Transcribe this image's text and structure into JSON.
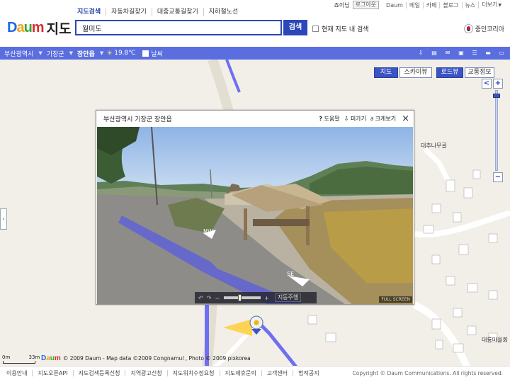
{
  "header": {
    "logo": {
      "d1": "D",
      "d2": "a",
      "d3": "u",
      "d4": "m"
    },
    "title": "지도",
    "tabs": [
      "지도검색",
      "자동차길찾기",
      "대중교통길찾기",
      "지하철노선"
    ],
    "search_value": "월미도",
    "search_button": "검색",
    "in_view_label": "현재 지도 내 검색",
    "user_nick": "죠이님",
    "logout": "로그아웃",
    "gnb": [
      "Daum",
      "메일",
      "카페",
      "블로그",
      "뉴스",
      "더보기"
    ],
    "gnb_more_arrow": "▼",
    "region": "중인코리아"
  },
  "location_bar": {
    "crumbs": [
      "부산광역시",
      "기장군",
      "장안읍"
    ],
    "separator": "▼",
    "weather_icon": "sun-icon",
    "temperature": "19.8℃",
    "weather_toggle": "날씨",
    "tools": [
      "download-icon",
      "print-icon",
      "mail-icon",
      "settings-icon",
      "list-icon",
      "bar-icon",
      "more-icon"
    ]
  },
  "map": {
    "view_tabs": [
      "지도",
      "스카이뷰",
      "로드뷰",
      "교통정보"
    ],
    "zoom_in": "+",
    "zoom_out": "−",
    "zoom_prev": "<",
    "places": [
      "대추나무골",
      "대룡마을회"
    ],
    "scale_start": "0m",
    "scale_end": "33m",
    "credit": "© 2009 Daum - Map data ©2009 Congnamul , Photo © 2009 pixkorea",
    "side_arrow": "›"
  },
  "roadview": {
    "address": "부산광역시 기장군 장안읍",
    "links": [
      "도움말",
      "퍼가기",
      "크게보기"
    ],
    "close": "×",
    "dir_nw": "NW",
    "dir_se": "SE",
    "jump_label": "지동주행",
    "full_screen": "FULL SCREEN"
  },
  "footer": {
    "links": [
      "이용안내",
      "지도오픈API",
      "지도검색등록신청",
      "지역광고신청",
      "지도위치수정요청",
      "지도제휴문의",
      "고객센터",
      "법적공지"
    ],
    "copyright": "Copyright © Daum Communications. All rights reserved."
  },
  "colors": {
    "brand_blue": "#2b47b9",
    "bar_blue": "#5a6ee0",
    "road_blue": "#6f6ff0"
  }
}
